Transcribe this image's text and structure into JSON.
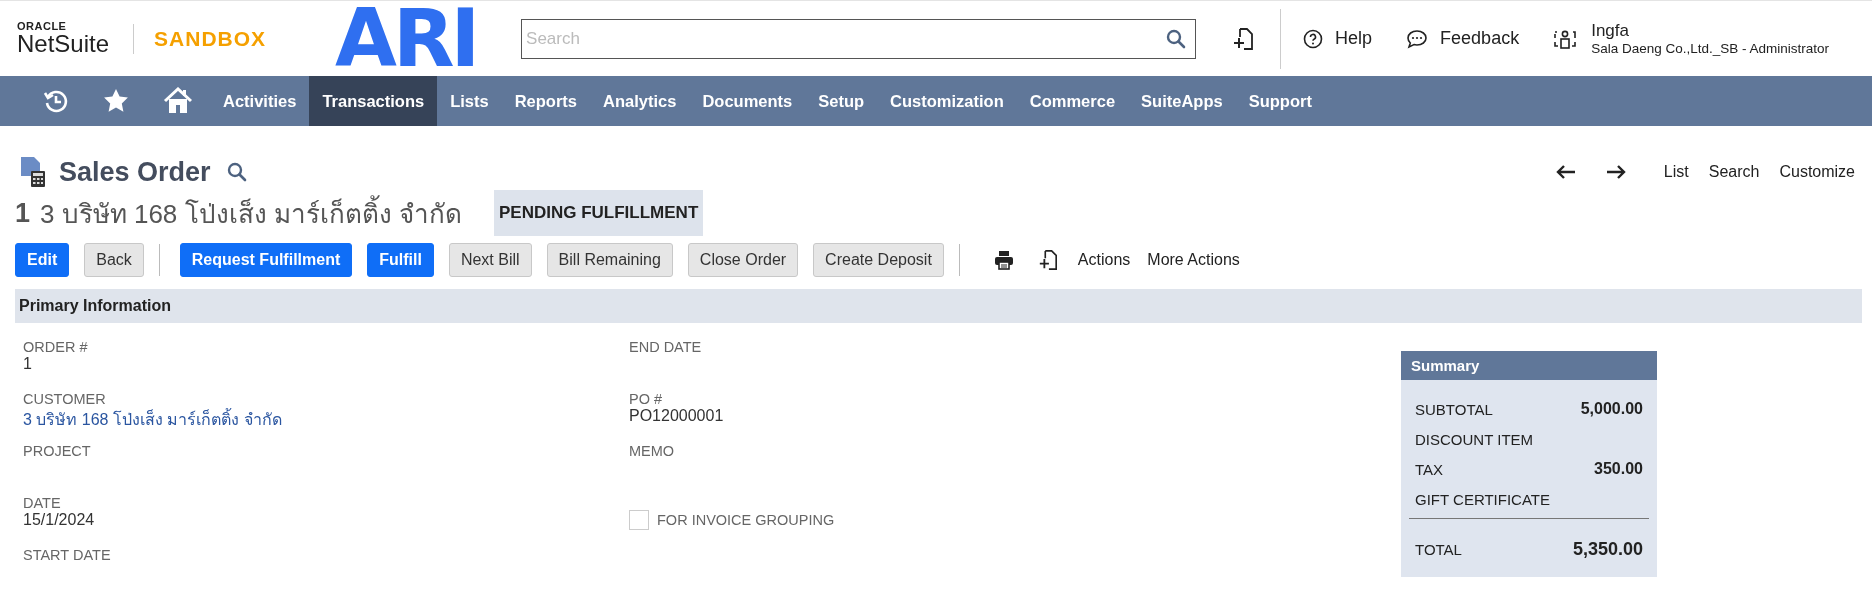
{
  "header": {
    "brand_top": "ORACLE",
    "brand": "NetSuite",
    "environment": "SANDBOX",
    "company_logo": "ARI",
    "search": {
      "placeholder": "Search"
    },
    "help": "Help",
    "feedback": "Feedback",
    "user": {
      "name": "Ingfa",
      "account": "Sala Daeng Co.,Ltd._SB - Administrator"
    }
  },
  "nav": [
    {
      "kind": "history",
      "selected": false
    },
    {
      "kind": "star",
      "selected": false
    },
    {
      "kind": "home",
      "selected": false
    },
    {
      "kind": "text",
      "label": "Activities",
      "selected": false
    },
    {
      "kind": "text",
      "label": "Transactions",
      "selected": true
    },
    {
      "kind": "text",
      "label": "Lists",
      "selected": false
    },
    {
      "kind": "text",
      "label": "Reports",
      "selected": false
    },
    {
      "kind": "text",
      "label": "Analytics",
      "selected": false
    },
    {
      "kind": "text",
      "label": "Documents",
      "selected": false
    },
    {
      "kind": "text",
      "label": "Setup",
      "selected": false
    },
    {
      "kind": "text",
      "label": "Customization",
      "selected": false
    },
    {
      "kind": "text",
      "label": "Commerce",
      "selected": false
    },
    {
      "kind": "text",
      "label": "SuiteApps",
      "selected": false
    },
    {
      "kind": "text",
      "label": "Support",
      "selected": false
    }
  ],
  "page": {
    "title": "Sales Order",
    "links": [
      "List",
      "Search",
      "Customize"
    ],
    "record_number": "1",
    "record_name": "3 บริษัท 168 โป่งเส็ง มาร์เก็ตติ้ง จำกัด",
    "status": "PENDING FULFILLMENT"
  },
  "buttons": [
    {
      "label": "Edit",
      "kind": "primary"
    },
    {
      "label": "Back",
      "kind": "secondary"
    },
    {
      "kind": "separator"
    },
    {
      "label": "Request Fulfillment",
      "kind": "primary"
    },
    {
      "label": "Fulfill",
      "kind": "primary"
    },
    {
      "label": "Next Bill",
      "kind": "secondary"
    },
    {
      "label": "Bill Remaining",
      "kind": "secondary"
    },
    {
      "label": "Close Order",
      "kind": "secondary"
    },
    {
      "label": "Create Deposit",
      "kind": "secondary"
    },
    {
      "kind": "separator"
    },
    {
      "kind": "print"
    },
    {
      "kind": "new-document"
    },
    {
      "label": "Actions",
      "kind": "menu"
    },
    {
      "label": "More Actions",
      "kind": "menu"
    }
  ],
  "primary_information": {
    "title": "Primary Information",
    "column_1": [
      {
        "label": "ORDER #",
        "value": "1",
        "kind": "text"
      },
      {
        "label": "CUSTOMER",
        "value": "3 บริษัท 168 โป่งเส็ง มาร์เก็ตติ้ง จำกัด",
        "kind": "link"
      },
      {
        "label": "PROJECT",
        "kind": "text"
      },
      {
        "label": "DATE",
        "value": "15/1/2024",
        "kind": "text"
      },
      {
        "label": "START DATE",
        "kind": "text"
      }
    ],
    "column_2": [
      {
        "label": "END DATE",
        "kind": "text"
      },
      {
        "label": "PO #",
        "value": "PO12000001",
        "kind": "text"
      },
      {
        "label": "MEMO",
        "kind": "text"
      },
      {
        "label": "FOR INVOICE GROUPING",
        "kind": "checkbox",
        "checked": false
      }
    ]
  },
  "summary": {
    "title": "Summary",
    "rows": [
      {
        "label": "SUBTOTAL",
        "value": "5,000.00"
      },
      {
        "label": "DISCOUNT ITEM"
      },
      {
        "label": "TAX",
        "value": "350.00"
      },
      {
        "label": "GIFT CERTIFICATE"
      }
    ],
    "total": {
      "label": "TOTAL",
      "value": "5,350.00"
    }
  }
}
